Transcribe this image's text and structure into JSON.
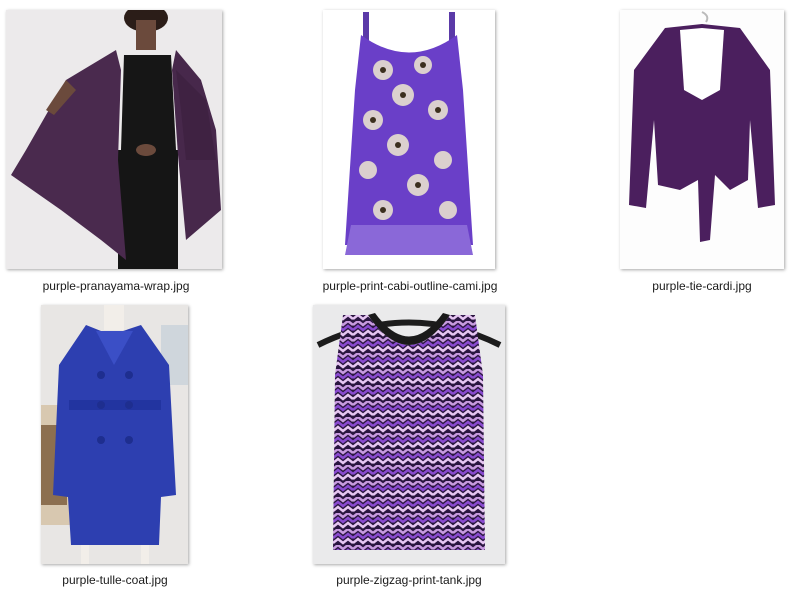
{
  "files": [
    {
      "name": "purple-pranayama-wrap.jpg",
      "thumbnail": "woman-in-purple-wrap-cardigan"
    },
    {
      "name": "purple-print-cabi-outline-cami.jpg",
      "thumbnail": "purple-floral-cami"
    },
    {
      "name": "purple-tie-cardi.jpg",
      "thumbnail": "purple-tie-cardigan-on-hanger"
    },
    {
      "name": "purple-tulle-coat.jpg",
      "thumbnail": "blue-purple-coat-on-mannequin"
    },
    {
      "name": "purple-zigzag-print-tank.jpg",
      "thumbnail": "purple-zigzag-tank-on-hanger"
    }
  ],
  "colors": {
    "wrap": "#4a2a4e",
    "cami": "#6a3fc8",
    "cardi": "#4b1f5e",
    "coat": "#2d3fb0",
    "zigzag": "#7a4aa8"
  }
}
